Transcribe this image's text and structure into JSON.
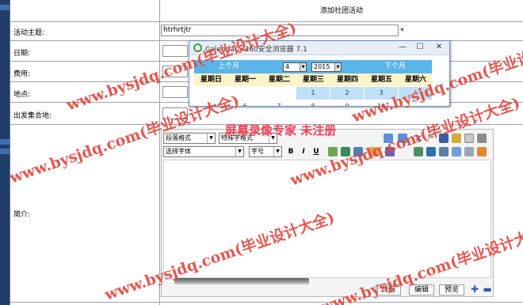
{
  "form": {
    "title": "添加社团活动",
    "fields": {
      "subject_label": "活动主题:",
      "subject_value": "htrhrtjtr",
      "required_mark": "*",
      "date_label": "日期:",
      "cost_label": "费用:",
      "location_label": "地点:",
      "gather_label": "出发集合地:",
      "intro_label": "简介:"
    }
  },
  "editor": {
    "paragraph_format": "段落格式",
    "special_format": "特殊字格式",
    "font_select": "选择字体",
    "font_size": "字号",
    "bold": "B",
    "italic": "I",
    "underline": "U",
    "tabs": [
      "代码",
      "编辑",
      "预览"
    ]
  },
  "calendar": {
    "window_title": "Calendar - 360安全浏览器 7.1",
    "prev_month": "上个月",
    "next_month": "下个月",
    "month": "4",
    "year": "2015",
    "weekdays": [
      "星期日",
      "星期一",
      "星期二",
      "星期三",
      "星期四",
      "星期五",
      "星期六"
    ],
    "week1": [
      "",
      "",
      "",
      "1",
      "2",
      "3",
      "4"
    ],
    "week2": [
      "5",
      "6",
      "7",
      "8",
      "9",
      "10",
      ""
    ]
  },
  "watermark": {
    "site": "www.bysjdq.com(毕业设计大全)",
    "recorder": "屏幕录像专家 未注册"
  },
  "colors": {
    "calendar_header": "#5ab4e8",
    "weekday_row": "#fbf3c9",
    "watermark": "#e0473f"
  }
}
